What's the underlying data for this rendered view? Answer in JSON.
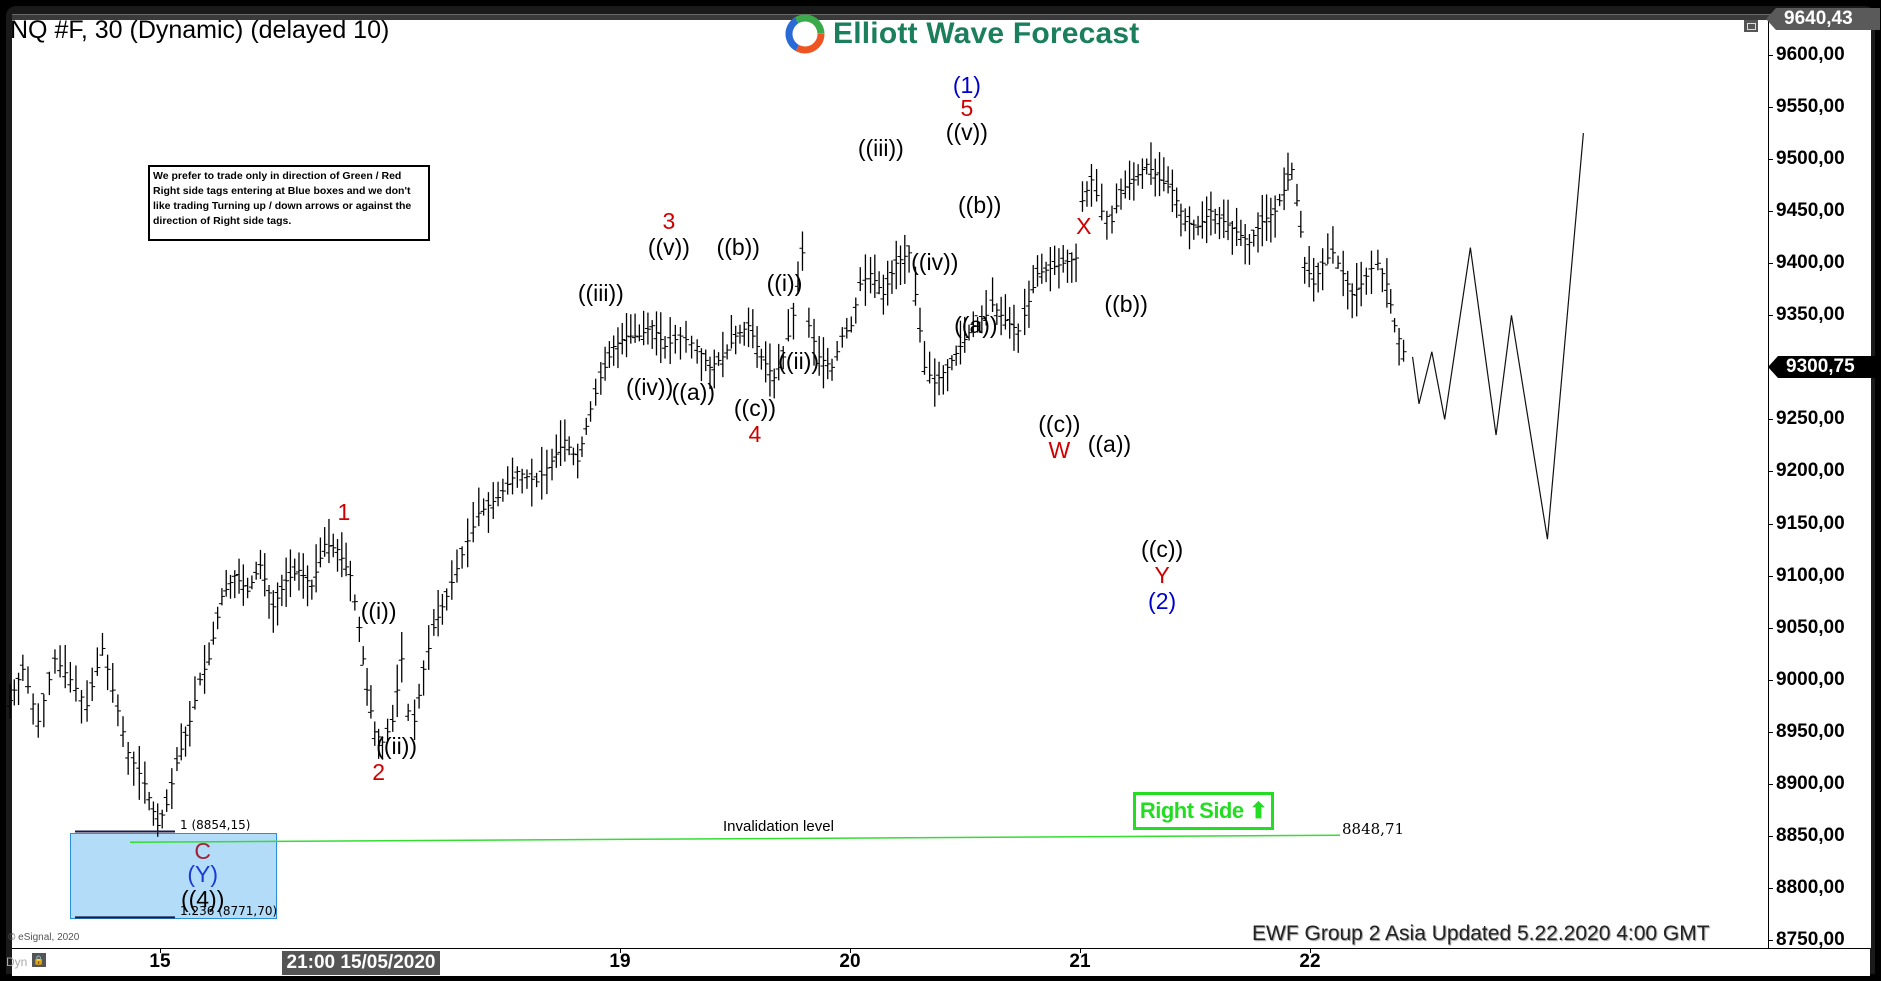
{
  "window": {
    "title": "NQ #F, 30 (Dynamic) (delayed 10)",
    "logo_text": "Elliott Wave Forecast",
    "notice": "We prefer to trade only in direction of Green / Red Right side tags entering at Blue boxes and we don't like trading Turning up / down arrows or against the direction of Right side tags.",
    "copyright": "© eSignal, 2020",
    "dyn_label": "Dyn",
    "footer": "EWF Group 2 Asia Updated 5.22.2020 4:00 GMT",
    "x_cursor_label": "21:00 15/05/2020",
    "high_price_tag": "9640,43",
    "current_price_tag": "9300,75"
  },
  "chart_data": {
    "type": "bar",
    "title": "NQ #F, 30 (Dynamic) (delayed 10)",
    "instrument": "NQ #F",
    "interval": "30 min",
    "xlabel": "",
    "ylabel": "",
    "ylim": [
      8750,
      9640
    ],
    "y_ticks": [
      "9600,00",
      "9550,00",
      "9500,00",
      "9450,00",
      "9400,00",
      "9350,00",
      "9250,00",
      "9200,00",
      "9150,00",
      "9100,00",
      "9050,00",
      "9000,00",
      "8950,00",
      "8900,00",
      "8850,00",
      "8800,00",
      "8750,00"
    ],
    "y_tick_values": [
      9600,
      9550,
      9500,
      9450,
      9400,
      9350,
      9250,
      9200,
      9150,
      9100,
      9050,
      9000,
      8950,
      8900,
      8850,
      8800,
      8750
    ],
    "x_ticks": [
      {
        "label": "15",
        "day": 15
      },
      {
        "label": "19",
        "day": 19
      },
      {
        "label": "20",
        "day": 20
      },
      {
        "label": "21",
        "day": 21
      },
      {
        "label": "22",
        "day": 22
      }
    ],
    "grid": false,
    "price_path": [
      [
        13.4,
        8980
      ],
      [
        13.5,
        9010
      ],
      [
        13.62,
        8960
      ],
      [
        13.75,
        9020
      ],
      [
        13.87,
        9000
      ],
      [
        14.0,
        8975
      ],
      [
        14.12,
        9030
      ],
      [
        14.2,
        8990
      ],
      [
        14.32,
        8930
      ],
      [
        14.45,
        8900
      ],
      [
        14.55,
        8860
      ],
      [
        14.62,
        8880
      ],
      [
        14.7,
        8920
      ],
      [
        14.8,
        8960
      ],
      [
        14.88,
        9000
      ],
      [
        14.95,
        9020
      ],
      [
        15.05,
        9080
      ],
      [
        15.15,
        9100
      ],
      [
        15.25,
        9085
      ],
      [
        15.35,
        9110
      ],
      [
        15.45,
        9070
      ],
      [
        15.55,
        9095
      ],
      [
        15.65,
        9105
      ],
      [
        15.75,
        9090
      ],
      [
        15.85,
        9130
      ],
      [
        15.95,
        9125
      ],
      [
        16.05,
        9100
      ],
      [
        16.12,
        9050
      ],
      [
        16.18,
        8990
      ],
      [
        16.24,
        8950
      ],
      [
        16.3,
        8940
      ],
      [
        16.38,
        8960
      ],
      [
        16.45,
        9020
      ],
      [
        16.5,
        8970
      ],
      [
        16.55,
        8960
      ],
      [
        16.62,
        9010
      ],
      [
        16.7,
        9050
      ],
      [
        16.8,
        9080
      ],
      [
        16.92,
        9120
      ],
      [
        17.05,
        9160
      ],
      [
        17.2,
        9175
      ],
      [
        17.35,
        9200
      ],
      [
        17.5,
        9190
      ],
      [
        17.62,
        9210
      ],
      [
        17.72,
        9230
      ],
      [
        17.82,
        9210
      ],
      [
        17.92,
        9260
      ],
      [
        18.0,
        9290
      ],
      [
        18.1,
        9320
      ],
      [
        18.2,
        9330
      ],
      [
        18.3,
        9330
      ],
      [
        18.4,
        9340
      ],
      [
        18.5,
        9320
      ],
      [
        18.62,
        9330
      ],
      [
        18.75,
        9320
      ],
      [
        18.85,
        9300
      ],
      [
        18.95,
        9310
      ],
      [
        19.05,
        9330
      ],
      [
        19.15,
        9340
      ],
      [
        19.25,
        9310
      ],
      [
        19.35,
        9290
      ],
      [
        19.42,
        9310
      ],
      [
        19.5,
        9350
      ],
      [
        19.57,
        9410
      ],
      [
        19.62,
        9340
      ],
      [
        19.7,
        9310
      ],
      [
        19.8,
        9300
      ],
      [
        19.88,
        9330
      ],
      [
        19.95,
        9340
      ],
      [
        20.02,
        9380
      ],
      [
        20.1,
        9390
      ],
      [
        20.2,
        9370
      ],
      [
        20.3,
        9400
      ],
      [
        20.4,
        9410
      ],
      [
        20.45,
        9370
      ],
      [
        20.52,
        9300
      ],
      [
        20.6,
        9285
      ],
      [
        20.7,
        9300
      ],
      [
        20.8,
        9320
      ],
      [
        20.9,
        9340
      ],
      [
        21.0,
        9350
      ],
      [
        21.05,
        9360
      ],
      [
        21.15,
        9345
      ],
      [
        21.25,
        9335
      ],
      [
        21.3,
        9350
      ],
      [
        21.4,
        9390
      ],
      [
        21.5,
        9395
      ],
      [
        21.6,
        9400
      ],
      [
        21.7,
        9405
      ],
      [
        21.75,
        9460
      ],
      [
        21.82,
        9480
      ],
      [
        21.9,
        9450
      ],
      [
        21.98,
        9440
      ],
      [
        22.05,
        9470
      ],
      [
        22.15,
        9480
      ],
      [
        22.25,
        9495
      ],
      [
        22.35,
        9480
      ],
      [
        22.45,
        9470
      ],
      [
        22.55,
        9440
      ],
      [
        22.65,
        9435
      ],
      [
        22.75,
        9450
      ],
      [
        22.85,
        9440
      ],
      [
        22.95,
        9430
      ],
      [
        23.05,
        9420
      ],
      [
        23.15,
        9440
      ],
      [
        23.25,
        9450
      ],
      [
        23.32,
        9470
      ],
      [
        23.38,
        9490
      ],
      [
        23.42,
        9460
      ],
      [
        23.48,
        9400
      ],
      [
        23.55,
        9380
      ],
      [
        23.62,
        9400
      ],
      [
        23.7,
        9410
      ],
      [
        23.78,
        9390
      ],
      [
        23.85,
        9370
      ],
      [
        23.92,
        9380
      ],
      [
        24.0,
        9395
      ],
      [
        24.05,
        9400
      ],
      [
        24.12,
        9380
      ],
      [
        24.18,
        9340
      ],
      [
        24.25,
        9315
      ],
      [
        24.3,
        9300
      ]
    ],
    "projected_path": [
      [
        24.32,
        9310
      ],
      [
        24.37,
        9265
      ],
      [
        24.47,
        9315
      ],
      [
        24.57,
        9250
      ],
      [
        24.77,
        9415
      ],
      [
        24.97,
        9235
      ],
      [
        25.09,
        9350
      ],
      [
        25.37,
        9135
      ],
      [
        25.65,
        9525
      ]
    ],
    "wave_labels": [
      {
        "text": "1",
        "color": "#d00000",
        "day": 16.0,
        "price": 9160
      },
      {
        "text": "2",
        "color": "#d00000",
        "day": 16.27,
        "price": 8910
      },
      {
        "text": "((i))",
        "color": "#000000",
        "day": 16.27,
        "price": 9065
      },
      {
        "text": "((ii))",
        "color": "#000000",
        "day": 16.41,
        "price": 8935
      },
      {
        "text": "((iii))",
        "color": "#000000",
        "day": 18.0,
        "price": 9370
      },
      {
        "text": "((iv))",
        "color": "#000000",
        "day": 18.38,
        "price": 9280
      },
      {
        "text": "3",
        "color": "#d00000",
        "day": 18.53,
        "price": 9440
      },
      {
        "text": "((v))",
        "color": "#000000",
        "day": 18.53,
        "price": 9415
      },
      {
        "text": "((a))",
        "color": "#000000",
        "day": 18.72,
        "price": 9275
      },
      {
        "text": "((b))",
        "color": "#000000",
        "day": 19.07,
        "price": 9415
      },
      {
        "text": "((c))",
        "color": "#000000",
        "day": 19.2,
        "price": 9260
      },
      {
        "text": "4",
        "color": "#d00000",
        "day": 19.2,
        "price": 9235
      },
      {
        "text": "((i))",
        "color": "#000000",
        "day": 19.43,
        "price": 9380
      },
      {
        "text": "((ii))",
        "color": "#000000",
        "day": 19.54,
        "price": 9305
      },
      {
        "text": "((iii))",
        "color": "#000000",
        "day": 20.18,
        "price": 9510
      },
      {
        "text": "((iv))",
        "color": "#000000",
        "day": 20.6,
        "price": 9400
      },
      {
        "text": "(1)",
        "color": "#0000cc",
        "day": 20.85,
        "price": 9570
      },
      {
        "text": "5",
        "color": "#d00000",
        "day": 20.85,
        "price": 9548
      },
      {
        "text": "((v))",
        "color": "#000000",
        "day": 20.85,
        "price": 9525
      },
      {
        "text": "((b))",
        "color": "#000000",
        "day": 20.95,
        "price": 9455
      },
      {
        "text": "((a))",
        "color": "#000000",
        "day": 20.92,
        "price": 9340
      },
      {
        "text": "((c))",
        "color": "#000000",
        "day": 21.57,
        "price": 9245
      },
      {
        "text": "W",
        "color": "#d00000",
        "day": 21.57,
        "price": 9220
      },
      {
        "text": "X",
        "color": "#d00000",
        "day": 21.76,
        "price": 9435
      },
      {
        "text": "((a))",
        "color": "#000000",
        "day": 21.96,
        "price": 9225
      },
      {
        "text": "((b))",
        "color": "#000000",
        "day": 22.09,
        "price": 9360
      },
      {
        "text": "((c))",
        "color": "#000000",
        "day": 22.37,
        "price": 9125
      },
      {
        "text": "Y",
        "color": "#d00000",
        "day": 22.37,
        "price": 9100
      },
      {
        "text": "(2)",
        "color": "#0000cc",
        "day": 22.37,
        "price": 9075
      },
      {
        "text": "C",
        "color": "#a0223a",
        "day": 14.9,
        "price": 8835
      },
      {
        "text": "(Y)",
        "color": "#1a3ad6",
        "day": 14.9,
        "price": 8812
      },
      {
        "text": "((4))",
        "color": "#000000",
        "day": 14.9,
        "price": 8788
      }
    ],
    "blue_box": {
      "fib_1_label": "1 (8854,15)",
      "fib_1_price": 8854.15,
      "fib_1236_label": "1.236 (8771,70)",
      "fib_1236_price": 8771.7
    },
    "invalidation": {
      "label": "Invalidation level",
      "price": 8848.71,
      "value_label": "8848,71",
      "color": "#33dd33"
    },
    "right_side_tag": {
      "label": "Right Side",
      "direction": "up",
      "color": "#22dd22"
    },
    "annotations": [
      "Invalidation level",
      "Right Side"
    ]
  }
}
